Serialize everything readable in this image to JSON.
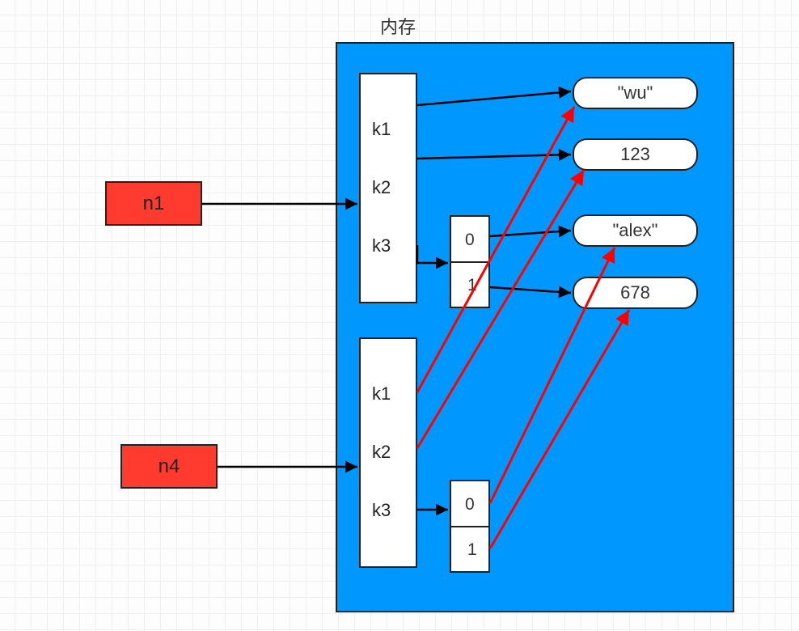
{
  "title": "内存",
  "variables": {
    "n1": "n1",
    "n4": "n4"
  },
  "dict1": {
    "k1": "k1",
    "k2": "k2",
    "k3": "k3"
  },
  "dict2": {
    "k1": "k1",
    "k2": "k2",
    "k3": "k3"
  },
  "list1": {
    "i0": "0",
    "i1": "1"
  },
  "list2": {
    "i0": "0",
    "i1": "1"
  },
  "values": {
    "wu": "\"wu\"",
    "v123": "123",
    "alex": "\"alex\"",
    "v678": "678"
  },
  "chart_data": {
    "type": "diagram",
    "description": "Two variables n1 and n4 each point to a dict {k1,k2,k3}. k1->\"wu\", k2->123, k3->list[0,1] where 0->\"alex\", 1->678. Both dicts share the same value objects.",
    "variables": [
      "n1",
      "n4"
    ],
    "shared_values": [
      "\"wu\"",
      123,
      "\"alex\"",
      678
    ],
    "dicts": [
      {
        "owner": "n1",
        "keys": {
          "k1": "\"wu\"",
          "k2": 123,
          "k3": {
            "list": [
              {
                "index": 0,
                "value": "\"alex\""
              },
              {
                "index": 1,
                "value": 678
              }
            ]
          }
        }
      },
      {
        "owner": "n4",
        "keys": {
          "k1": "\"wu\"",
          "k2": 123,
          "k3": {
            "list": [
              {
                "index": 0,
                "value": "\"alex\""
              },
              {
                "index": 1,
                "value": 678
              }
            ]
          }
        }
      }
    ]
  }
}
